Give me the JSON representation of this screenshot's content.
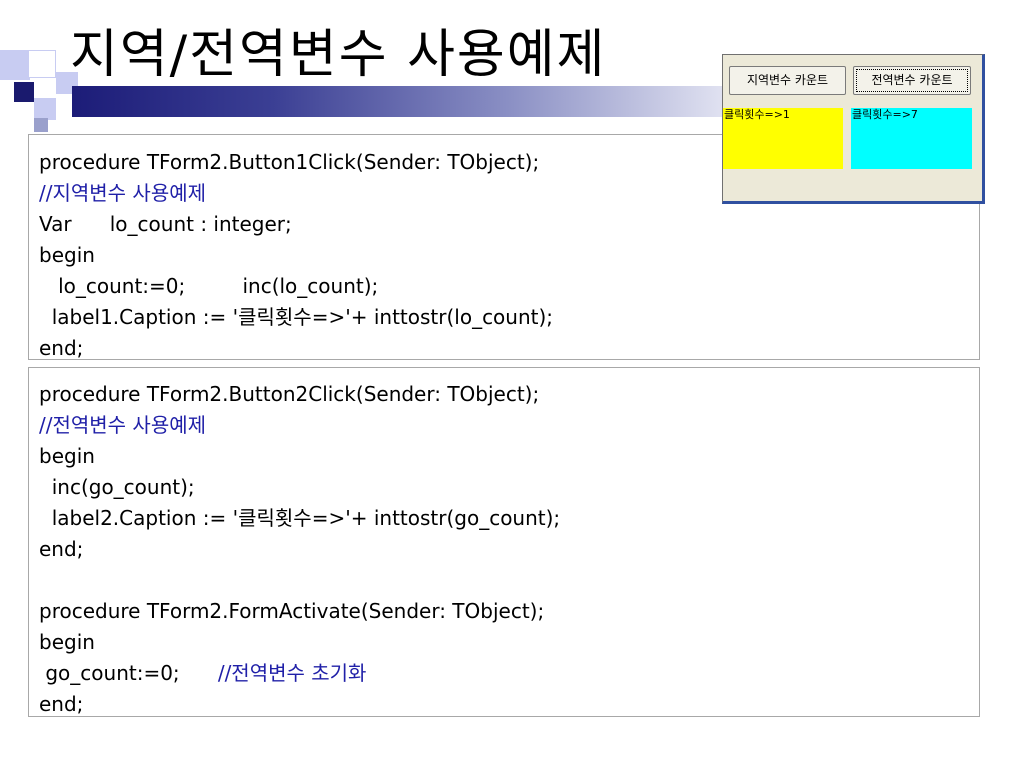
{
  "slide": {
    "title": "지역/전역변수 사용예제"
  },
  "code_block_1": {
    "lines": [
      "procedure TForm2.Button1Click(Sender: TObject);",
      "//지역변수 사용예제",
      "Var      lo_count : integer;",
      "begin",
      "   lo_count:=0;         inc(lo_count);",
      "  label1.Caption := '클릭횟수=>'+ inttostr(lo_count);",
      "end;"
    ]
  },
  "code_block_2": {
    "lines": [
      "procedure TForm2.Button2Click(Sender: TObject);",
      "//전역변수 사용예제",
      "begin",
      "  inc(go_count);",
      "  label2.Caption := '클릭횟수=>'+ inttostr(go_count);",
      "end;",
      "",
      "procedure TForm2.FormActivate(Sender: TObject);",
      "begin",
      " go_count:=0;      "
    ],
    "inline_comment": "//전역변수 초기화",
    "last_line": "end;"
  },
  "app_window": {
    "button1_label": "지역변수 카운트",
    "button2_label": "전역변수 카운트",
    "label1_text": "클릭횟수=>1",
    "label2_text": "클릭횟수=>7",
    "label1_color": "#ffff00",
    "label2_color": "#00ffff"
  },
  "colors": {
    "comment": "#2020a8",
    "accent_bar_dark": "#1c1c78"
  }
}
